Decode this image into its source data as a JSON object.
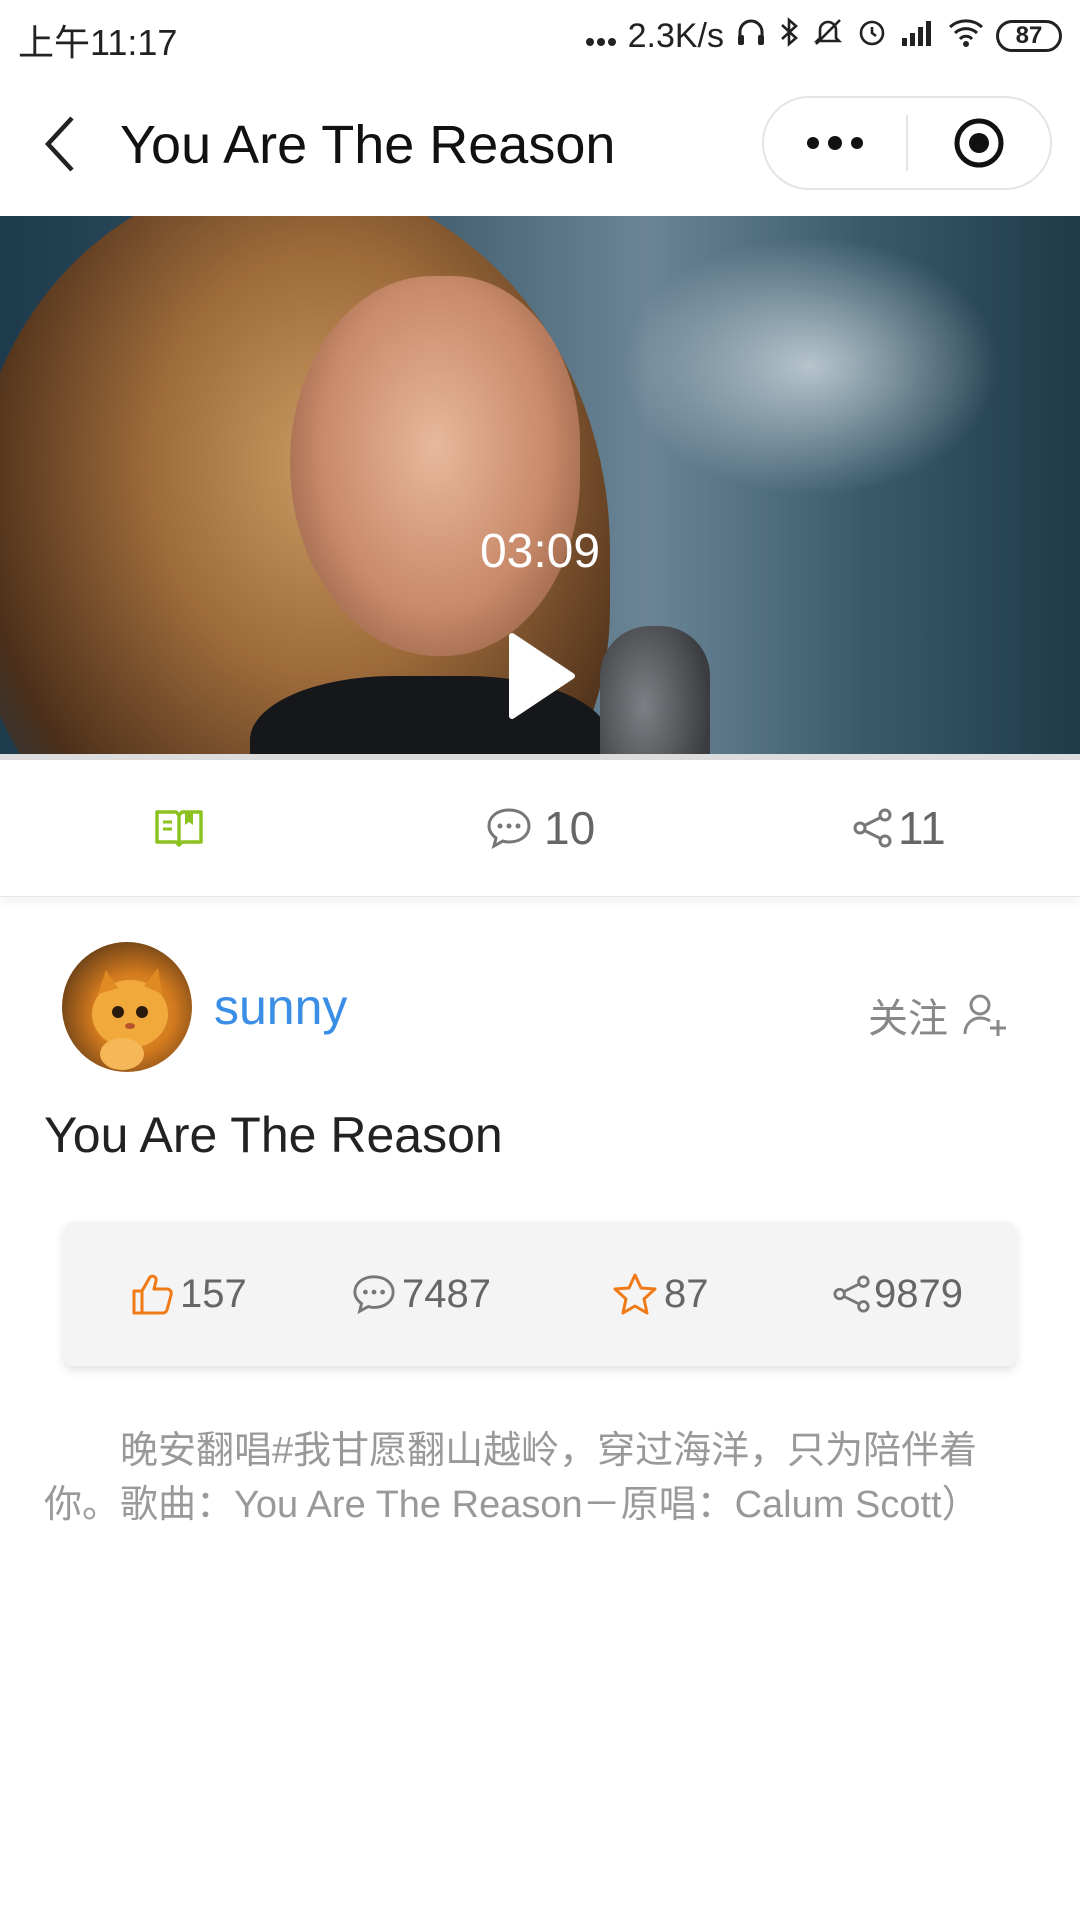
{
  "status_bar": {
    "time": "上午11:17",
    "network_speed": "2.3K/s",
    "battery": "87",
    "icons": [
      "headphones-icon",
      "bluetooth-icon",
      "mute-icon",
      "alarm-icon",
      "hd-signal-icon",
      "wifi-icon",
      "battery-icon"
    ]
  },
  "nav": {
    "title": "You Are The Reason",
    "icons": [
      "back-arrow-icon",
      "more-dots-icon",
      "target-icon"
    ]
  },
  "video": {
    "duration": "03:09",
    "progress": 0
  },
  "action_bar": {
    "comments": "10",
    "shares": "11",
    "accent_color": "#8cc220",
    "icons": [
      "book-icon",
      "comment-icon",
      "share-icon"
    ]
  },
  "author": {
    "name": "sunny",
    "follow_label": "关注",
    "name_color": "#3a8ee6"
  },
  "post": {
    "title": "You Are The Reason",
    "description": "晚安翻唱#我甘愿翻山越岭，穿过海洋，只为陪伴着你。歌曲：You Are The Reason－原唱：Calum Scott）"
  },
  "stats": {
    "likes": "157",
    "comments": "7487",
    "favorites": "87",
    "shares": "9879",
    "accent_color": "#f07a16"
  }
}
